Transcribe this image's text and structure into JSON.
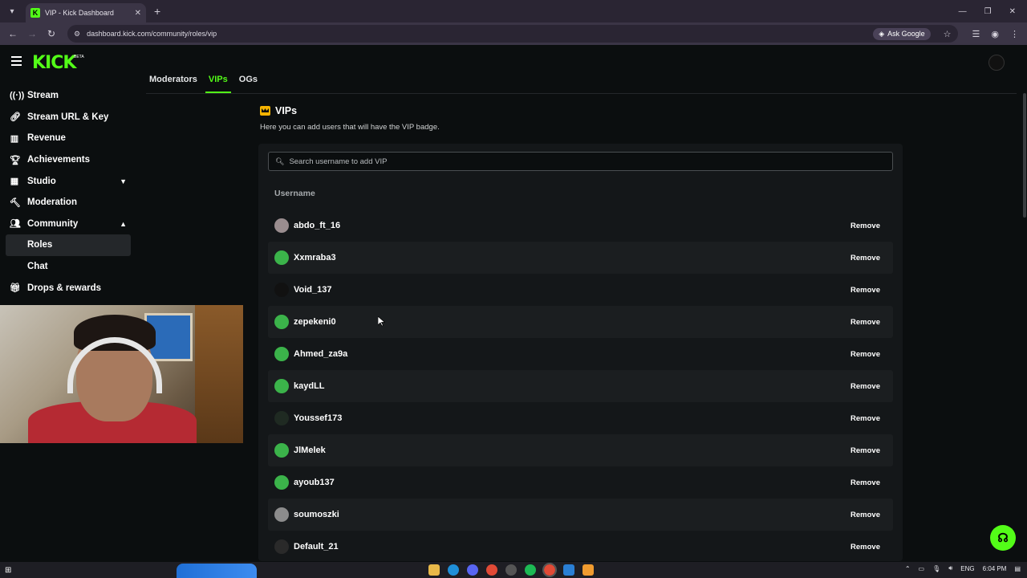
{
  "browser": {
    "tab_title": "VIP - Kick Dashboard",
    "url": "dashboard.kick.com/community/roles/vip",
    "ask_google": "Ask Google"
  },
  "header": {
    "logo": "KICK",
    "beta": "BETA"
  },
  "sidebar": {
    "items": [
      {
        "label": "Stream",
        "icon": "signal-icon"
      },
      {
        "label": "Stream URL & Key",
        "icon": "link-icon"
      },
      {
        "label": "Revenue",
        "icon": "chart-icon"
      },
      {
        "label": "Achievements",
        "icon": "trophy-icon"
      },
      {
        "label": "Studio",
        "icon": "layout-icon"
      },
      {
        "label": "Moderation",
        "icon": "hammer-icon"
      },
      {
        "label": "Community",
        "icon": "users-icon"
      }
    ],
    "sub_items": [
      {
        "label": "Roles"
      },
      {
        "label": "Chat"
      }
    ],
    "drops": {
      "label": "Drops & rewards",
      "icon": "gift-icon"
    }
  },
  "role_tabs": [
    "Moderators",
    "VIPs",
    "OGs"
  ],
  "section": {
    "title": "VIPs",
    "description": "Here you can add users that will have the VIP badge."
  },
  "search": {
    "placeholder": "Search username to add VIP"
  },
  "table": {
    "column": "Username",
    "remove_label": "Remove",
    "users": [
      {
        "name": "abdo_ft_16",
        "avatar_color": "#9a8d8f"
      },
      {
        "name": "Xxmraba3",
        "avatar_color": "#3bb34a"
      },
      {
        "name": "Void_137",
        "avatar_color": "#111111"
      },
      {
        "name": "zepekeni0",
        "avatar_color": "#3bb34a"
      },
      {
        "name": "Ahmed_za9a",
        "avatar_color": "#3bb34a"
      },
      {
        "name": "kaydLL",
        "avatar_color": "#3bb34a"
      },
      {
        "name": "Youssef173",
        "avatar_color": "#1f2a22"
      },
      {
        "name": "JlMelek",
        "avatar_color": "#3bb34a"
      },
      {
        "name": "ayoub137",
        "avatar_color": "#3bb34a"
      },
      {
        "name": "soumoszki",
        "avatar_color": "#8c8c8c"
      },
      {
        "name": "Default_21",
        "avatar_color": "#2a2a2a"
      }
    ]
  },
  "taskbar": {
    "lang": "ENG",
    "time": "6:04 PM"
  },
  "colors": {
    "accent": "#53fc18",
    "background": "#0b0e0f",
    "panel": "#141719"
  }
}
